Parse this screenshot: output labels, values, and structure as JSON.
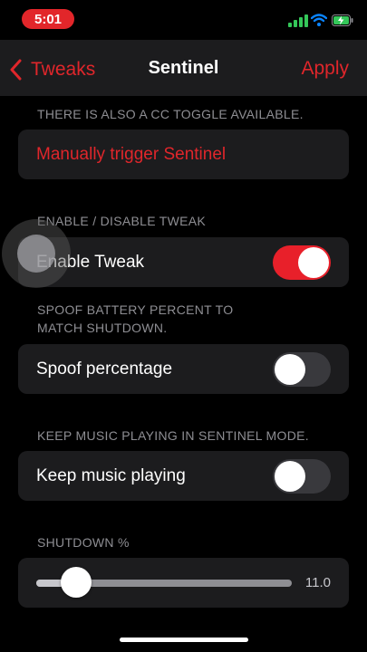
{
  "status": {
    "time": "5:01"
  },
  "nav": {
    "back_label": "Tweaks",
    "title": "Sentinel",
    "apply_label": "Apply"
  },
  "sections": {
    "cc": {
      "header": "THERE IS ALSO A CC TOGGLE AVAILABLE.",
      "button_label": "Manually trigger Sentinel"
    },
    "enable": {
      "header": "ENABLE / DISABLE TWEAK",
      "label": "Enable Tweak",
      "on": true
    },
    "spoof": {
      "header_line1": "SPOOF BATTERY PERCENT TO",
      "header_line2": "MATCH SHUTDOWN.",
      "label": "Spoof percentage",
      "on": false
    },
    "music": {
      "header": "KEEP MUSIC PLAYING IN SENTINEL MODE.",
      "label": "Keep music playing",
      "on": false
    },
    "shutdown": {
      "header": "SHUTDOWN %",
      "value": "11.0",
      "fraction": 0.11
    }
  },
  "colors": {
    "accent": "#e0262b",
    "cell_bg": "#1c1c1e",
    "header_text": "#8e8e93"
  }
}
